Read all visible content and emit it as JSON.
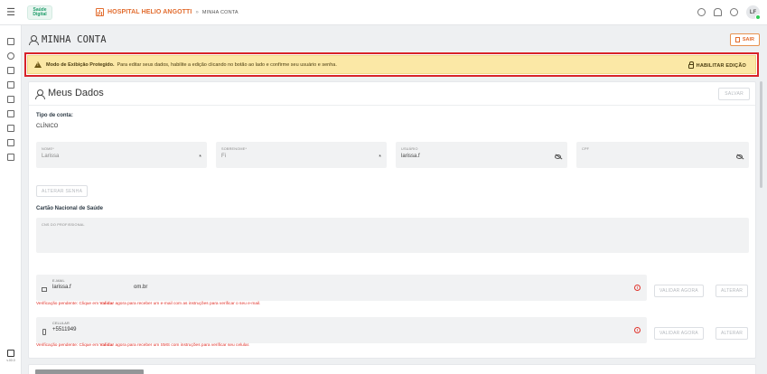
{
  "topbar": {
    "logo_text": "Saúde Digital",
    "hospital": "HOSPITAL HELIO ANGOTTI",
    "separator": "»",
    "page": "MINHA CONTA",
    "avatar_initials": "LF"
  },
  "sidebar": {
    "bottom_label": "v.00.0"
  },
  "header": {
    "title": "MINHA CONTA",
    "logout_label": "SAIR"
  },
  "alert": {
    "title": "Modo de Exibição Protegido.",
    "message": "Para editar seus dados, habilite a edição clicando no botão ao lado e confirme seu usuário e senha.",
    "action_label": "HABILITAR EDIÇÃO"
  },
  "card": {
    "title": "Meus Dados",
    "save_label": "SALVAR",
    "tipo_label": "Tipo de conta:",
    "tipo_value": "CLÍNICO",
    "fields": {
      "nome": {
        "label": "NOME*",
        "value": "Larissa",
        "required": "*"
      },
      "sobrenome": {
        "label": "SOBRENOME*",
        "value": "Fi",
        "required": "*"
      },
      "usuario": {
        "label": "USUÁRIO",
        "value": "larissa.f"
      },
      "cpf": {
        "label": "CPF",
        "value": ""
      }
    },
    "change_password_label": "ALTERAR SENHA",
    "cns_section": "Cartão Nacional de Saúde",
    "cns_field_label": "CNS DO PROFISSIONAL",
    "email": {
      "label": "E-MAIL",
      "value": "larissa.f",
      "value_suffix": "om.br",
      "verify_label": "VALIDAR AGORA",
      "change_label": "ALTERAR",
      "pending_prefix": "Verificação pendente: Clique em ",
      "pending_bold": "Validar",
      "pending_suffix": " agora para receber um e-mail com as instruções para verificar o seu e-mail."
    },
    "phone": {
      "label": "CELULAR",
      "value": "+5511949",
      "verify_label": "VALIDAR AGORA",
      "change_label": "ALTERAR",
      "pending_prefix": "Verificação pendente: Clique em ",
      "pending_bold": "Validar",
      "pending_suffix": " agora para receber um SMS com instruções para verificar seu celular."
    }
  },
  "colors": {
    "accent": "#e26c2e",
    "alert_bg": "#fbe8a6",
    "alert_border": "#d8232a",
    "error": "#e0342c"
  }
}
